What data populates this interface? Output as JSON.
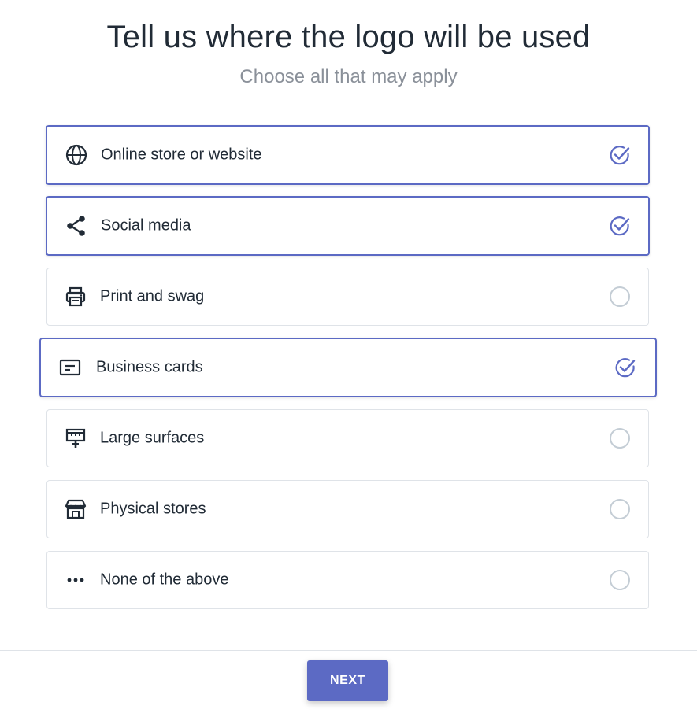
{
  "header": {
    "title": "Tell us where the logo will be used",
    "subtitle": "Choose all that may apply"
  },
  "options": [
    {
      "label": "Online store or website",
      "icon": "globe-icon",
      "selected": true
    },
    {
      "label": "Social media",
      "icon": "share-icon",
      "selected": true
    },
    {
      "label": "Print and swag",
      "icon": "printer-icon",
      "selected": false
    },
    {
      "label": "Business cards",
      "icon": "business-card-icon",
      "selected": true
    },
    {
      "label": "Large surfaces",
      "icon": "billboard-icon",
      "selected": false
    },
    {
      "label": "Physical stores",
      "icon": "storefront-icon",
      "selected": false
    },
    {
      "label": "None of the above",
      "icon": "ellipsis-icon",
      "selected": false
    }
  ],
  "footer": {
    "next_label": "NEXT"
  },
  "colors": {
    "accent": "#5c6ac4",
    "border": "#dfe3e8",
    "text": "#212b36",
    "subdued": "#8a9099",
    "radio_empty": "#c4cdd5"
  }
}
